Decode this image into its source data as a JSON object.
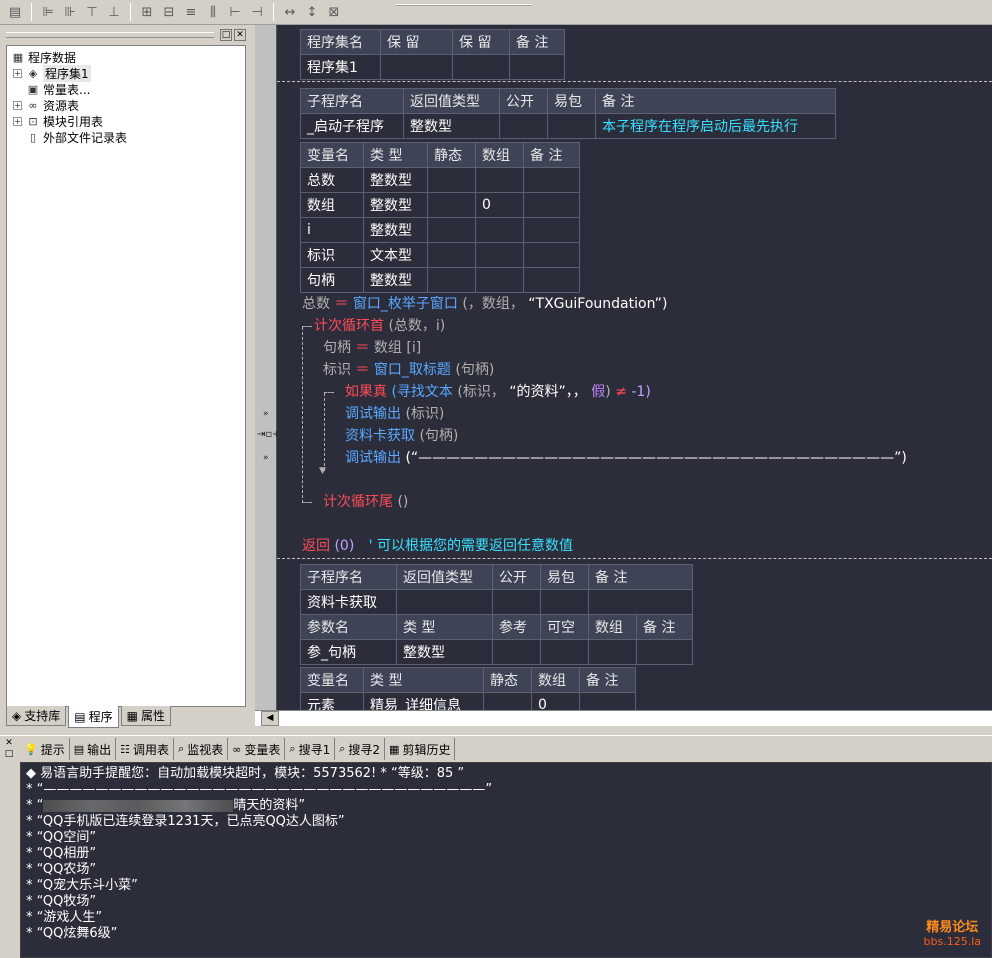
{
  "toolbar": {
    "icons": [
      "doc-icon",
      "align-left-icon",
      "align-right-icon",
      "align-top-icon",
      "align-bottom-icon",
      "center-h-icon",
      "center-v-icon",
      "same-width-icon",
      "same-height-icon",
      "space-h-icon",
      "space-v-icon",
      "fit-width-icon",
      "fit-height-icon",
      "fit-both-icon"
    ]
  },
  "left_panel": {
    "tree": {
      "root": "程序数据",
      "items": [
        "程序集1",
        "常量表...",
        "资源表",
        "模块引用表",
        "外部文件记录表"
      ]
    },
    "tabs": [
      "支持库",
      "程序",
      "属性"
    ]
  },
  "editor": {
    "assembly_table": {
      "headers": [
        "程序集名",
        "保 留",
        "保 留",
        "备 注"
      ],
      "row": [
        "程序集1",
        "",
        "",
        ""
      ]
    },
    "sub1": {
      "headers": [
        "子程序名",
        "返回值类型",
        "公开",
        "易包",
        "备 注"
      ],
      "row": [
        "_启动子程序",
        "整数型",
        "",
        "",
        "本子程序在程序启动后最先执行"
      ]
    },
    "vars1": {
      "headers": [
        "变量名",
        "类 型",
        "静态",
        "数组",
        "备 注"
      ],
      "rows": [
        [
          "总数",
          "整数型",
          "",
          "",
          ""
        ],
        [
          "数组",
          "整数型",
          "",
          "0",
          ""
        ],
        [
          "i",
          "整数型",
          "",
          "",
          ""
        ],
        [
          "标识",
          "文本型",
          "",
          "",
          ""
        ],
        [
          "句柄",
          "整数型",
          "",
          "",
          ""
        ]
      ]
    },
    "code": {
      "l1_a": "总数",
      "l1_eq": "＝",
      "l1_fn": "窗口_枚举子窗口",
      "l1_args": "(，数组，",
      "l1_str": "“TXGuiFoundation”",
      "l1_close": ")",
      "l2_kw": "计次循环首",
      "l2_args": "(总数，i)",
      "l3_a": "句柄",
      "l3_eq": "＝",
      "l3_b": "数组 [i]",
      "l4_a": "标识",
      "l4_eq": "＝",
      "l4_fn": "窗口_取标题",
      "l4_args": "(句柄)",
      "l5_kw": "如果真",
      "l5_fn": "(寻找文本",
      "l5_args": "(标识，",
      "l5_str": "“的资料”，，",
      "l5_false": "假",
      "l5_close": ")",
      "l5_ne": "≠",
      "l5_num": "-1)",
      "l6_fn": "调试输出",
      "l6_args": "(标识)",
      "l7_fn": "资料卡获取",
      "l7_args": "(句柄)",
      "l8_fn": "调试输出",
      "l8_args": "(“——————————————————————————————————”)",
      "l9_kw": "计次循环尾",
      "l9_args": "()",
      "l10_kw": "返回",
      "l10_args": "(0)",
      "l10_comment": "' 可以根据您的需要返回任意数值"
    },
    "sub2": {
      "headers": [
        "子程序名",
        "返回值类型",
        "公开",
        "易包",
        "备 注"
      ],
      "row": [
        "资料卡获取",
        "",
        "",
        "",
        ""
      ],
      "param_headers": [
        "参数名",
        "类 型",
        "参考",
        "可空",
        "数组",
        "备 注"
      ],
      "param_row": [
        "参_句柄",
        "整数型",
        "",
        "",
        "",
        ""
      ]
    },
    "vars2": {
      "headers": [
        "变量名",
        "类 型",
        "静态",
        "数组",
        "备 注"
      ],
      "row": [
        "元素",
        "精易_详细信息",
        "",
        "0",
        ""
      ]
    }
  },
  "output_tabs": [
    "提示",
    "输出",
    "调用表",
    "监视表",
    "变量表",
    "搜寻1",
    "搜寻2",
    "剪辑历史"
  ],
  "output_lines": [
    "◆ 易语言助手提醒您：自动加载模块超时，模块：5573562! *  “等级：85 ”",
    "*  “——————————————————————————————————”",
    "晴天的资料”",
    "*  “QQ手机版已连续登录1231天，已点亮QQ达人图标”",
    "*  “QQ空间”",
    "*  “QQ相册”",
    "*  “QQ农场”",
    "*  “Q宠大乐斗小菜”",
    "*  “QQ牧场”",
    "*  “游戏人生”",
    "*  “QQ炫舞6级”"
  ],
  "output_line3_prefix": "*  “",
  "watermark": {
    "line1": "精易论坛",
    "line2": "bbs.125.la"
  },
  "colors": {
    "editor_bg": "#2b2d3a",
    "keyword": "#ff4a57",
    "function": "#5aa8ff",
    "comment": "#38e0ff"
  }
}
